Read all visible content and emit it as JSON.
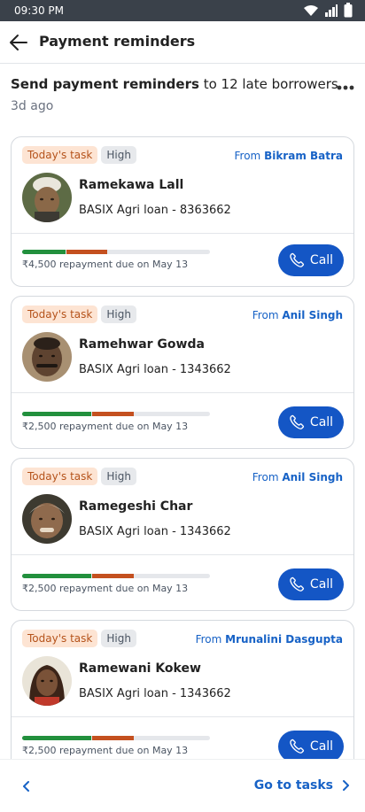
{
  "status_bar": {
    "time": "09:30 PM"
  },
  "header": {
    "title": "Payment reminders"
  },
  "task": {
    "title_bold": "Send payment reminders",
    "title_rest": " to 12 late borrowers",
    "ago": "3d ago",
    "more_icon": "more-horizontal-icon"
  },
  "colors": {
    "accent": "#1456c5",
    "link": "#1762c6",
    "badge_today_bg": "#fde4d3",
    "bar_green": "#22903d",
    "bar_orange": "#c4501f"
  },
  "cards": [
    {
      "badge_today": "Today's task",
      "badge_priority": "High",
      "from_prefix": "From ",
      "from_name": "Bikram Batra",
      "name": "Ramekawa Lall",
      "loan": "BASIX Agri loan - 8363662",
      "due": "₹4,500 repayment due on May 13",
      "call": "Call",
      "progress_green": 0.23,
      "progress_orange": 0.22
    },
    {
      "badge_today": "Today's task",
      "badge_priority": "High",
      "from_prefix": "From ",
      "from_name": "Anil Singh",
      "name": "Ramehwar Gowda",
      "loan": "BASIX Agri loan - 1343662",
      "due": "₹2,500 repayment due on May 13",
      "call": "Call",
      "progress_green": 0.37,
      "progress_orange": 0.22
    },
    {
      "badge_today": "Today's task",
      "badge_priority": "High",
      "from_prefix": "From ",
      "from_name": "Anil Singh",
      "name": "Ramegeshi Char",
      "loan": "BASIX Agri loan - 1343662",
      "due": "₹2,500 repayment due on May 13",
      "call": "Call",
      "progress_green": 0.37,
      "progress_orange": 0.22
    },
    {
      "badge_today": "Today's task",
      "badge_priority": "High",
      "from_prefix": "From ",
      "from_name": "Mrunalini Dasgupta",
      "name": "Ramewani Kokew",
      "loan": "BASIX Agri loan - 1343662",
      "due": "₹2,500 repayment due on May 13",
      "call": "Call",
      "progress_green": 0.37,
      "progress_orange": 0.22
    }
  ],
  "footer": {
    "goto_label": "Go to tasks"
  }
}
